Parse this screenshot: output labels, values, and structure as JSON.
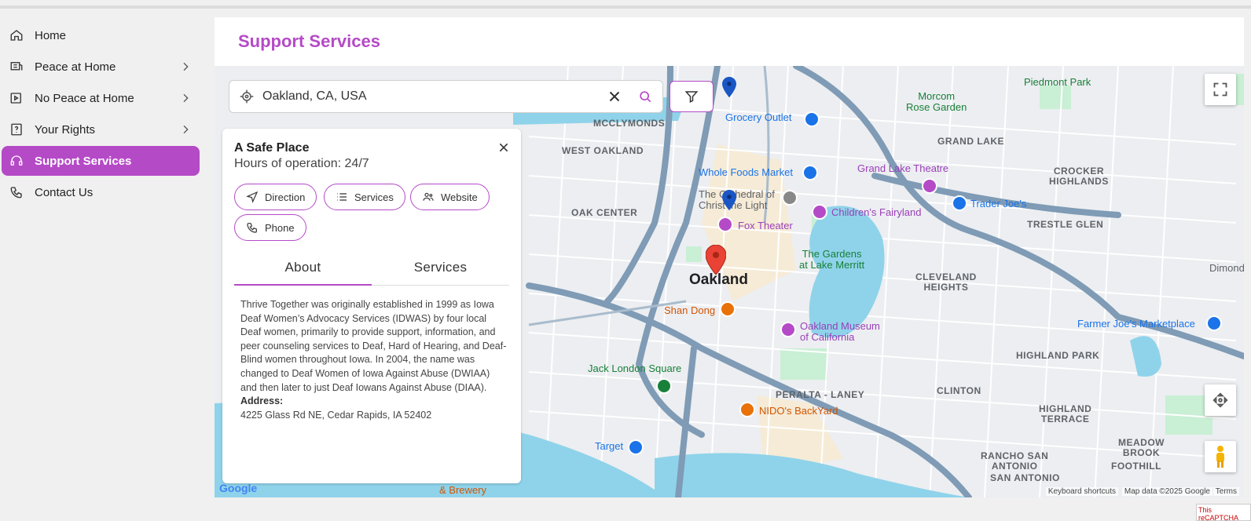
{
  "sidebar": {
    "items": [
      {
        "label": "Home",
        "icon": "home-icon",
        "chevron": false,
        "active": false
      },
      {
        "label": "Peace at Home",
        "icon": "peace-icon",
        "chevron": true,
        "active": false
      },
      {
        "label": "No Peace at Home",
        "icon": "video-icon",
        "chevron": true,
        "active": false
      },
      {
        "label": "Your Rights",
        "icon": "rights-icon",
        "chevron": true,
        "active": false
      },
      {
        "label": "Support Services",
        "icon": "support-icon",
        "chevron": false,
        "active": true
      },
      {
        "label": "Contact Us",
        "icon": "phone-icon",
        "chevron": false,
        "active": false
      }
    ]
  },
  "page": {
    "title": "Support Services"
  },
  "search": {
    "value": "Oakland, CA, USA"
  },
  "card": {
    "title": "A Safe Place",
    "hours": "Hours of operation: 24/7",
    "buttons": {
      "direction": "Direction",
      "services": "Services",
      "website": "Website",
      "phone": "Phone"
    },
    "tabs": {
      "about": "About",
      "services": "Services"
    },
    "about_text": "Thrive Together was originally established in 1999 as Iowa Deaf Women’s Advocacy Services (IDWAS) by four local Deaf women, primarily to provide support, information, and peer counseling services to Deaf, Hard of Hearing, and Deaf-Blind women throughout Iowa. In 2004, the name was changed to Deaf Women of Iowa Against Abuse (DWIAA) and then later to just Deaf Iowans Against Abuse (DIAA).",
    "address_label": "Address:",
    "address": "4225 Glass Rd NE, Cedar Rapids, IA 52402"
  },
  "map": {
    "labels": {
      "mcclymonds": "MCCLYMONDS",
      "west_oakland": "WEST OAKLAND",
      "oak_center": "OAK CENTER",
      "grand_lake": "GRAND LAKE",
      "crocker_highlands": "CROCKER\nHIGHLANDS",
      "trestle_glen": "TRESTLE GLEN",
      "cleveland_heights": "CLEVELAND\nHEIGHTS",
      "highland_park": "HIGHLAND PARK",
      "clinton": "CLINTON",
      "peralta_laney": "PERALTA - LANEY",
      "highland_terrace": "HIGHLAND\nTERRACE",
      "meadow_brook": "MEADOW\nBROOK",
      "rancho_san_antonio": "RANCHO SAN\nANTONIO",
      "foothill": "FOOTHILL",
      "san_antonio": "SAN ANTONIO",
      "dimond": "Dimond",
      "oakland": "Oakland",
      "piedmont_park": "Piedmont Park",
      "morcom_rose_garden": "Morcom\nRose Garden",
      "gardens_lake_merritt": "The Gardens\nat Lake Merritt",
      "grocery_outlet": "Grocery Outlet",
      "whole_foods": "Whole Foods Market",
      "trader_joes": "Trader Joe's",
      "farmer_joes": "Farmer Joe's Marketplace",
      "target": "Target",
      "grand_lake_theatre": "Grand Lake Theatre",
      "childrens_fairyland": "Children's Fairyland",
      "fox_theater": "Fox Theater",
      "cathedral": "The Cathedral of\nChrist the Light",
      "oakland_museum": "Oakland Museum\nof California",
      "shan_dong": "Shan Dong",
      "nidos": "NIDO's BackYard",
      "jack_london": "Jack London Square",
      "brewery": "& Brewery"
    },
    "attribution": {
      "shortcuts": "Keyboard shortcuts",
      "mapdata": "Map data ©2025 Google",
      "terms": "Terms",
      "logo": "Google"
    },
    "captcha": "This reCAPTCHA"
  },
  "colors": {
    "accent": "#b54ac7",
    "water": "#8fd3ea",
    "road": "#7f9bb5"
  }
}
